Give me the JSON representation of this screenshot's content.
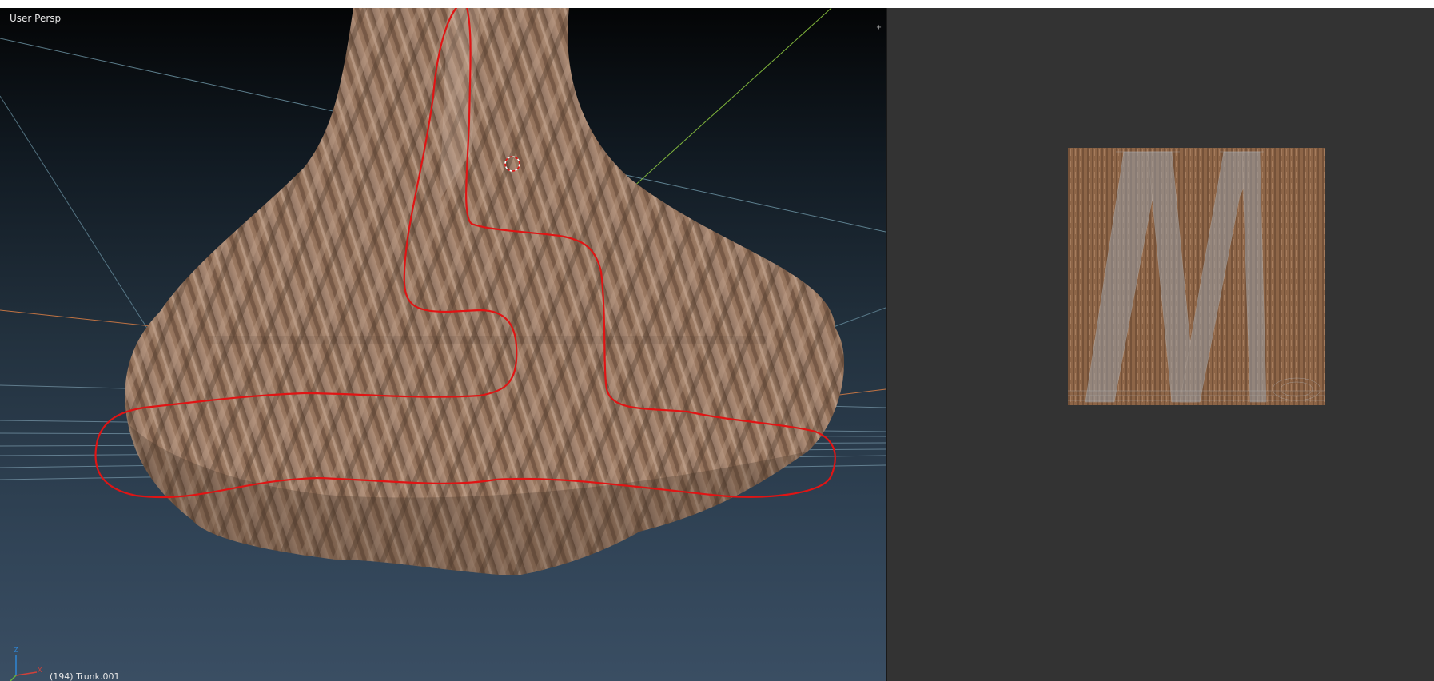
{
  "viewport": {
    "view_label": "User Persp",
    "object_info": "(194) Trunk.001",
    "axis_gizmo": {
      "z_label": "Z",
      "x_label": "X",
      "z_color": "#2f86d6",
      "x_color": "#d0413a",
      "y_color": "#63b63f"
    }
  },
  "colors": {
    "viewport_bg_top": "#040506",
    "viewport_bg_bottom": "#3a4e63",
    "bark_base": "#8a6a52",
    "bark_light": "#c2a28c",
    "bark_dark": "#5e4533",
    "annotation_stroke": "#e01414",
    "uv_editor_bg": "#333333",
    "uv_wire": "#9aa0a6",
    "grid_line": "#8fb5c7",
    "x_axis_line": "#d07a44",
    "y_axis_line": "#8cc63f"
  },
  "icons": {
    "split_left": "plus-icon",
    "split_right": "plus-icon",
    "cursor": "3d-cursor-icon"
  },
  "uv_editor": {
    "texture": "bark-texture-with-uv-wireframe"
  }
}
